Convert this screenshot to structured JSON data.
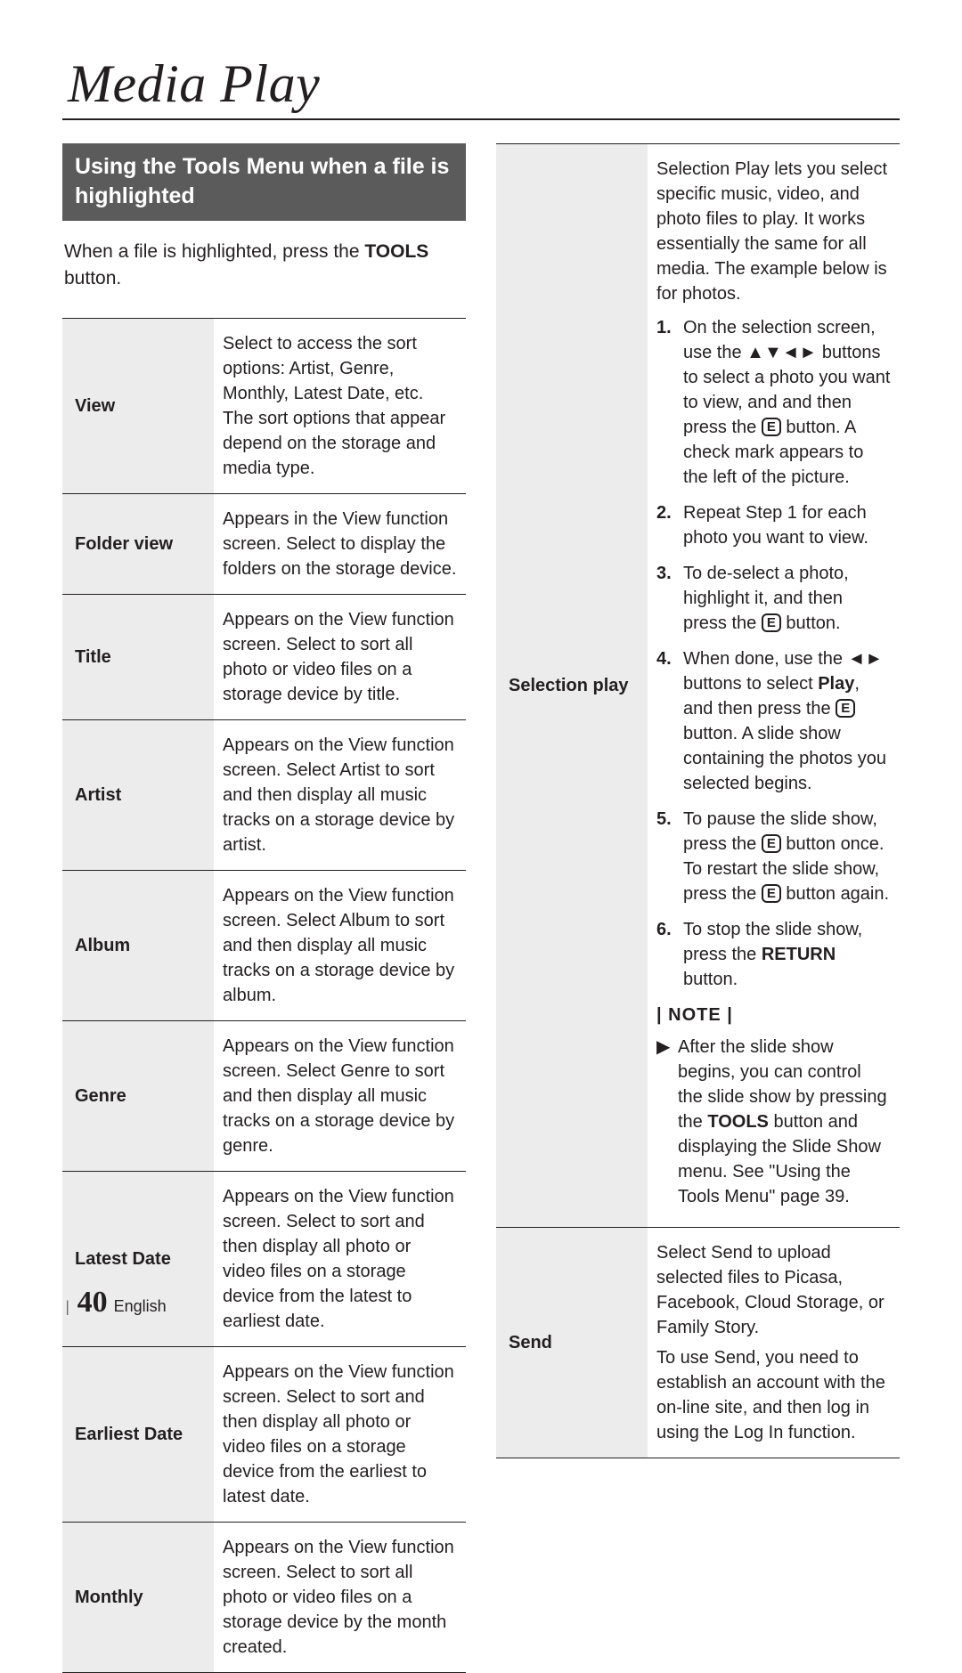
{
  "header": {
    "title": "Media Play"
  },
  "section": {
    "heading": "Using the Tools Menu when a file is highlighted",
    "intro_pre": "When a file is highlighted, press the ",
    "intro_bold": "TOOLS",
    "intro_post": " button."
  },
  "left_table": [
    {
      "label": "View",
      "desc": "Select to access the sort options: Artist, Genre, Monthly, Latest Date, etc. The sort options that appear depend on the storage and media type."
    },
    {
      "label": "Folder view",
      "desc": "Appears in the View function screen. Select to display the folders on the storage device."
    },
    {
      "label": "Title",
      "desc": "Appears on the View function screen. Select to sort all photo or video files on a storage device by title."
    },
    {
      "label": "Artist",
      "desc": "Appears on the View function screen. Select Artist to sort and then display all music tracks on a storage device by artist."
    },
    {
      "label": "Album",
      "desc": "Appears on the View function screen. Select Album to sort and then display all music tracks on a storage device by album."
    },
    {
      "label": "Genre",
      "desc": "Appears on the View function screen. Select Genre to sort and then display all music tracks on a storage device by genre."
    },
    {
      "label": "Latest Date",
      "desc": "Appears on the View function screen. Select to sort and then display all photo or video files on a storage device from the latest to earliest date."
    },
    {
      "label": "Earliest Date",
      "desc": "Appears on the View function screen. Select to sort and then display all photo or video files on a storage device from the earliest to latest date."
    },
    {
      "label": "Monthly",
      "desc": "Appears on the View function screen. Select to sort all photo or video files on a storage device by the month created."
    }
  ],
  "right": {
    "selection": {
      "label": "Selection play",
      "intro": "Selection Play lets you select specific music, video, and photo files to play. It works essentially the same for all media. The example below is for photos.",
      "steps": {
        "s1_a": "On the selection screen, use the ▲▼◄► buttons to select a photo you want to view, and and then press the ",
        "s1_b": " button. A check mark appears to the left of the picture.",
        "s2": "Repeat Step 1 for each photo you want to view.",
        "s3_a": "To de-select a photo, highlight it, and then press the ",
        "s3_b": " button.",
        "s4_a": "When done, use the ◄► buttons to select ",
        "s4_play": "Play",
        "s4_b": ", and then press the ",
        "s4_c": " button. A slide show containing the photos you selected begins.",
        "s5_a": "To pause the slide show, press the ",
        "s5_b": " button once. To restart the slide show, press the ",
        "s5_c": " button again.",
        "s6_a": "To stop the slide show, press the ",
        "s6_return": "RETURN",
        "s6_b": " button."
      },
      "note_head": "| NOTE |",
      "note_a": "After the slide show begins, you can control the slide show by pressing the ",
      "note_tools": "TOOLS",
      "note_b": " button and displaying the Slide Show menu. See \"Using the Tools Menu\" page 39."
    },
    "send": {
      "label": "Send",
      "p1": "Select Send to upload selected files to Picasa, Facebook, Cloud Storage, or Family Story.",
      "p2": "To use Send, you need to establish an account with the on-line site, and then log in using the Log In function."
    }
  },
  "footer": {
    "bar": "|",
    "page": "40",
    "lang": "English"
  },
  "icons": {
    "e_glyph": "E"
  }
}
